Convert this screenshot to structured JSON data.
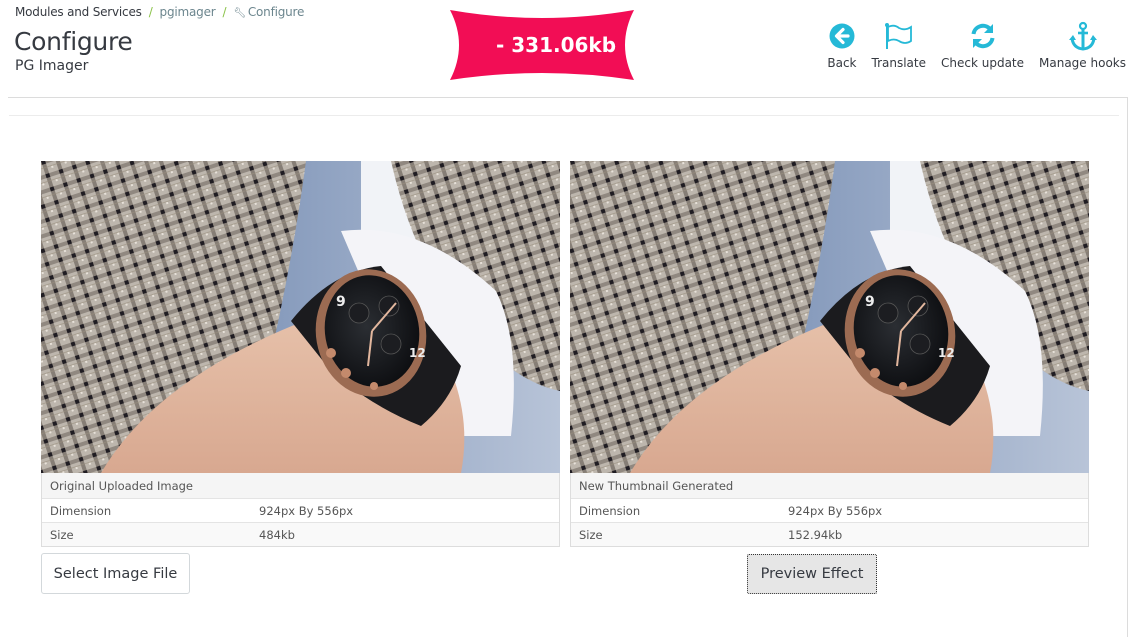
{
  "breadcrumb": {
    "items": [
      "Modules and Services",
      "pgimager",
      "Configure"
    ],
    "separator": "/"
  },
  "header": {
    "title": "Configure",
    "subtitle": "PG Imager"
  },
  "savings_badge": {
    "text": "- 331.06kb",
    "color": "#f20d55"
  },
  "toolbar": {
    "accent_color": "#25b9d7",
    "items": [
      {
        "label": "Back",
        "icon": "arrow-circle-left-icon"
      },
      {
        "label": "Translate",
        "icon": "flag-icon"
      },
      {
        "label": "Check update",
        "icon": "refresh-icon"
      },
      {
        "label": "Manage hooks",
        "icon": "anchor-icon"
      }
    ]
  },
  "original": {
    "heading": "Original Uploaded Image",
    "rows": [
      {
        "label": "Dimension",
        "value": "924px By 556px"
      },
      {
        "label": "Size",
        "value": "484kb"
      }
    ],
    "image_alt": "Wrist watch on a man's wrist with plaid jacket sleeve"
  },
  "thumbnail": {
    "heading": "New Thumbnail Generated",
    "rows": [
      {
        "label": "Dimension",
        "value": "924px By 556px"
      },
      {
        "label": "Size",
        "value": "152.94kb"
      }
    ],
    "image_alt": "Wrist watch on a man's wrist with plaid jacket sleeve"
  },
  "buttons": {
    "select_image": "Select Image File",
    "preview_effect": "Preview Effect"
  }
}
